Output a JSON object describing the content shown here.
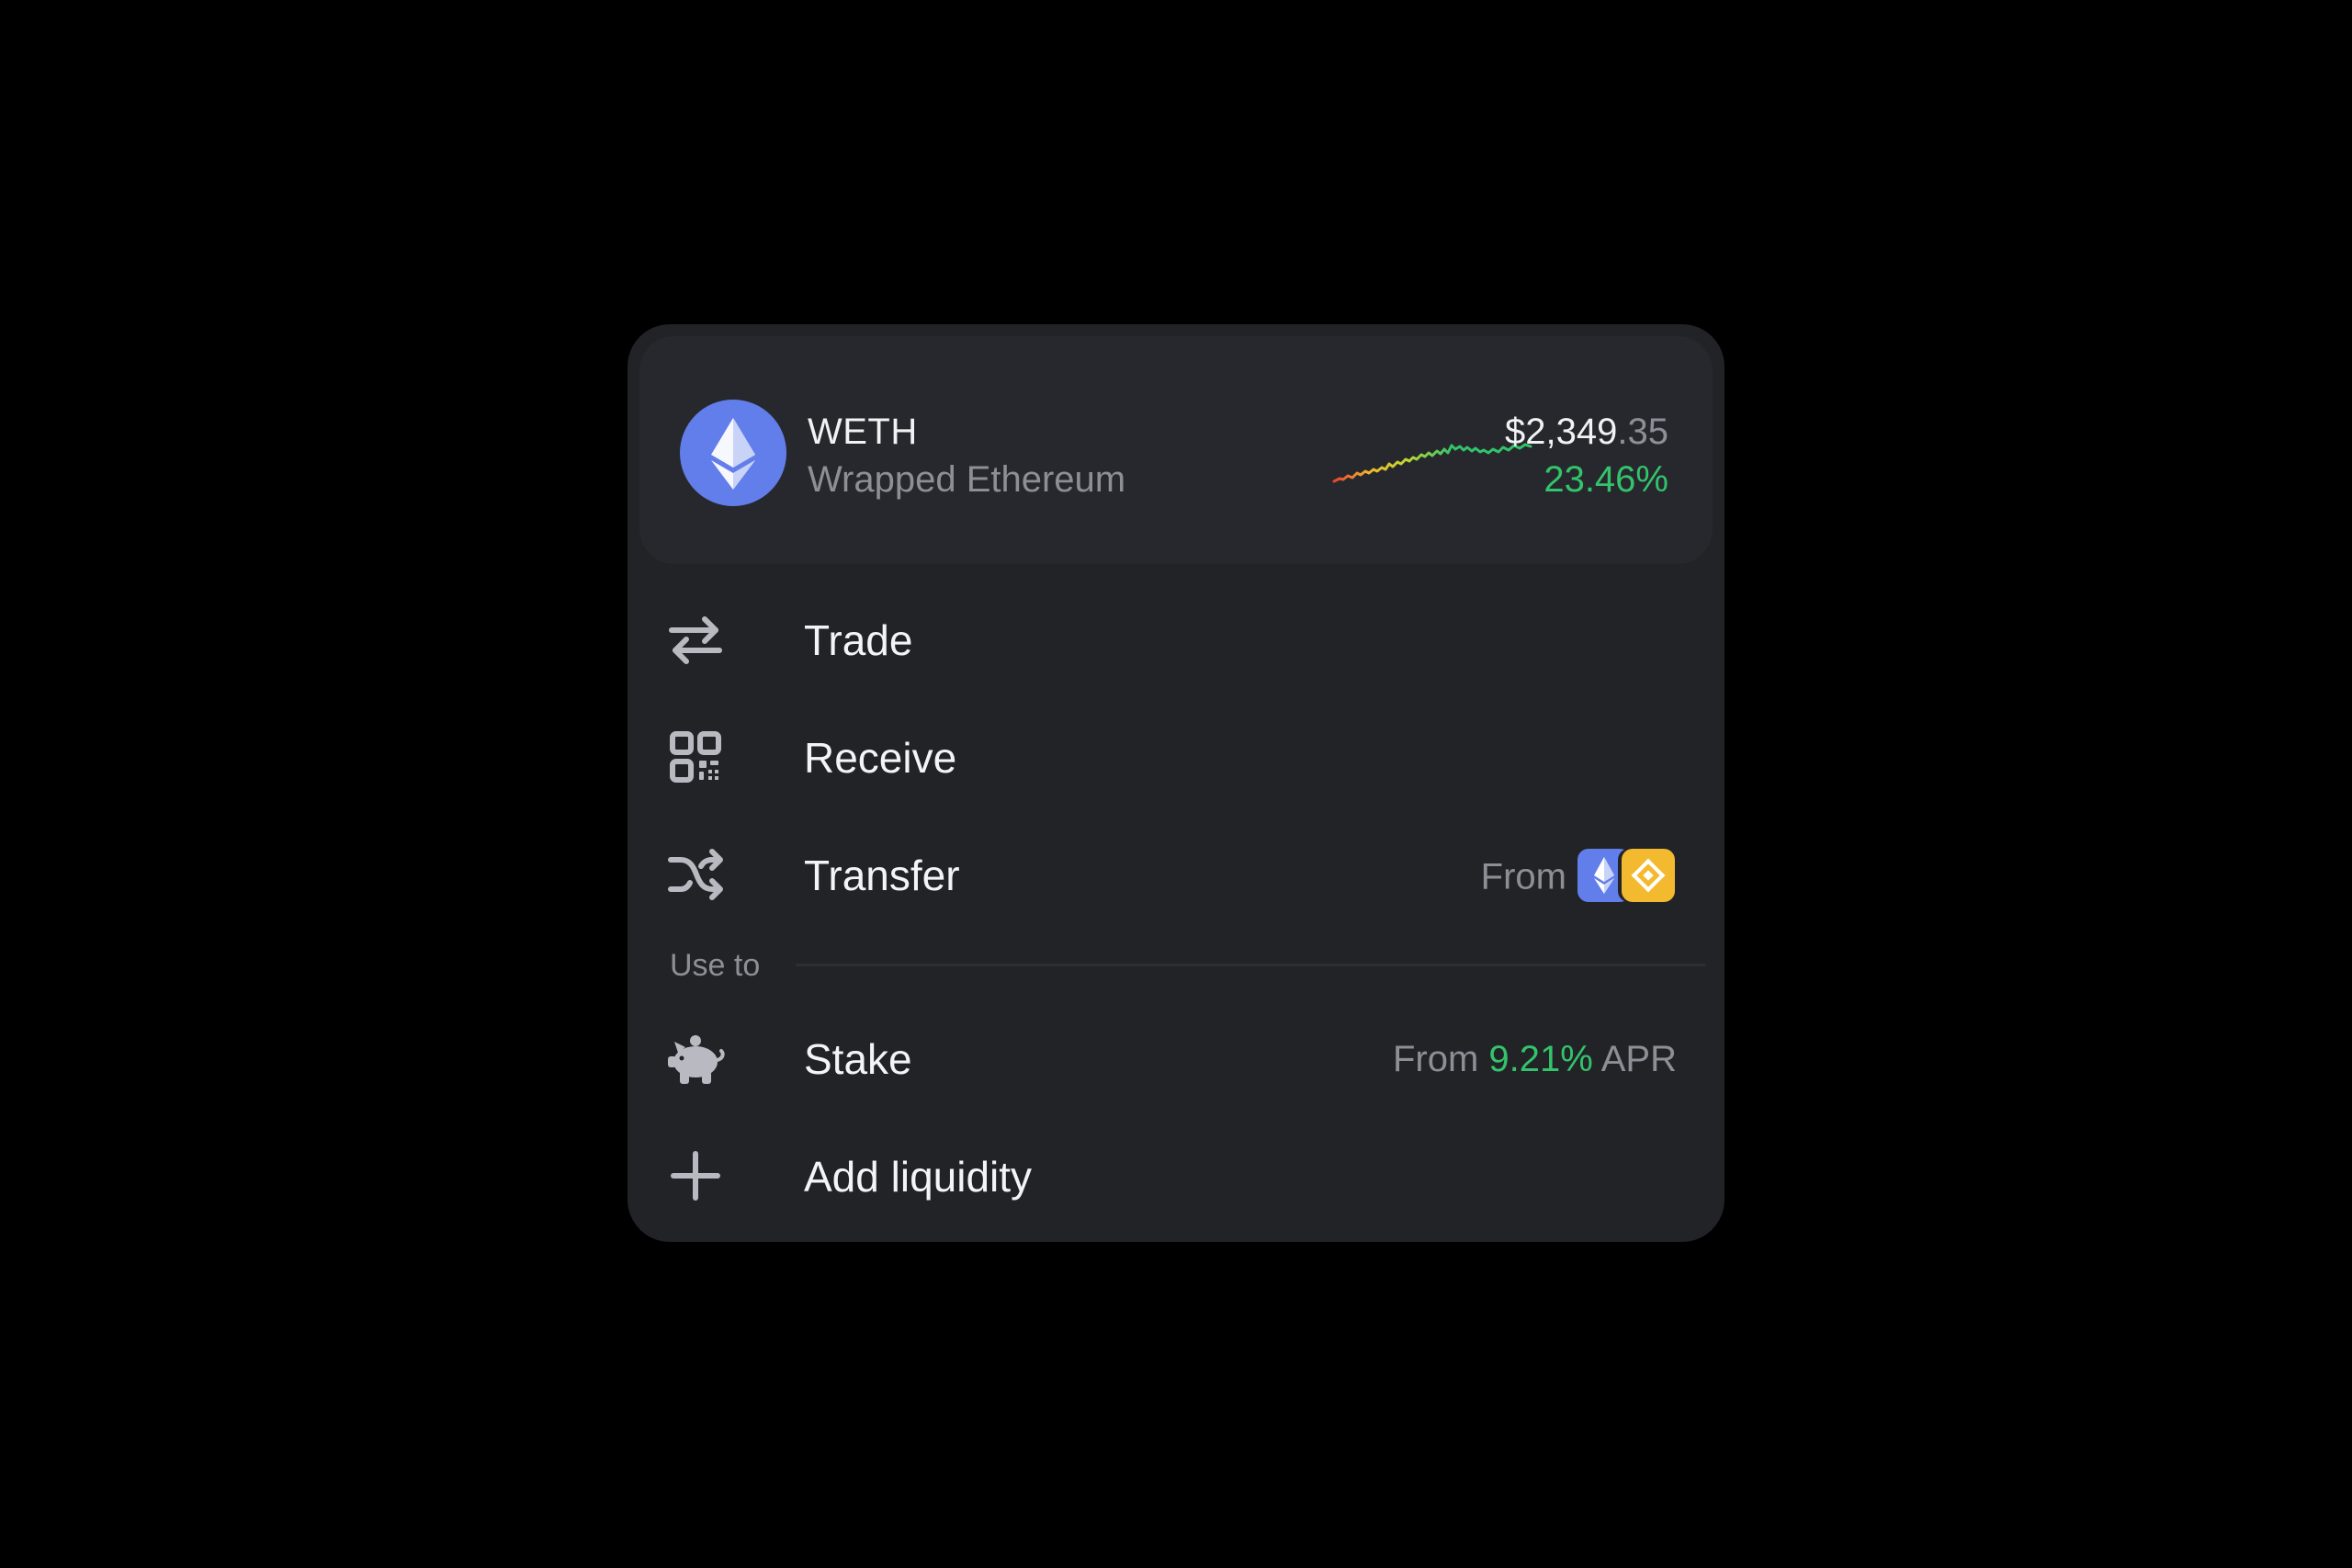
{
  "token": {
    "symbol": "WETH",
    "name": "Wrapped Ethereum",
    "price_main": "$2,349",
    "price_cents": ".35",
    "change": "23.46%",
    "logo_icon": "ethereum-icon",
    "sparkline_trend": "up",
    "colors": {
      "eth_blue": "#627eea",
      "positive": "#33c36b"
    }
  },
  "actions": [
    {
      "label": "Trade",
      "icon": "swap-arrows-icon"
    },
    {
      "label": "Receive",
      "icon": "qr-code-icon"
    },
    {
      "label": "Transfer",
      "icon": "shuffle-icon",
      "meta_prefix": "From",
      "chains": [
        "ethereum-icon",
        "bnb-icon"
      ]
    }
  ],
  "section": {
    "label": "Use to"
  },
  "use_to": [
    {
      "label": "Stake",
      "icon": "piggy-bank-icon",
      "meta_prefix": "From",
      "apr_value": "9.21%",
      "apr_suffix": "APR"
    },
    {
      "label": "Add liquidity",
      "icon": "plus-icon"
    }
  ],
  "colors": {
    "background": "#000000",
    "card": "#222327",
    "header": "#27282d",
    "bnb_yellow": "#f3ba2f"
  }
}
